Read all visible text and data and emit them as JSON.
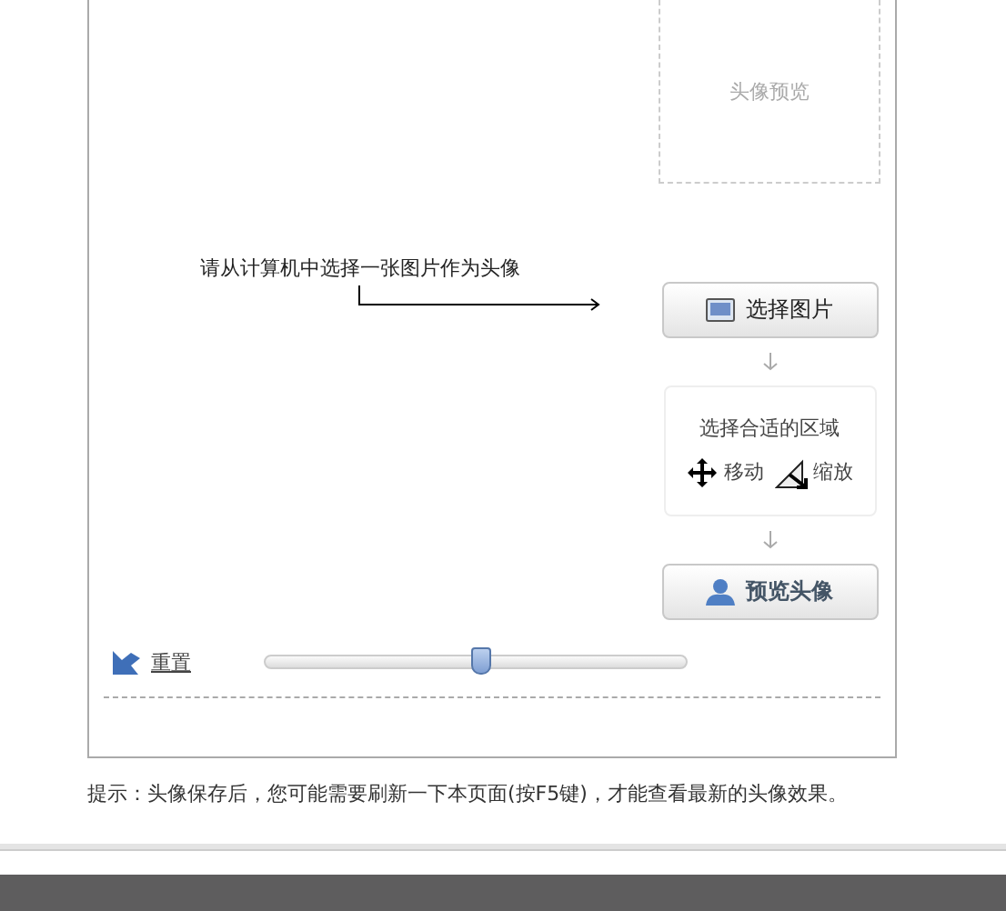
{
  "preview": {
    "label": "头像预览"
  },
  "instruction": "请从计算机中选择一张图片作为头像",
  "select_button": "选择图片",
  "area": {
    "title": "选择合适的区域",
    "tools": [
      {
        "kind": "move",
        "label": "移动"
      },
      {
        "kind": "scale",
        "label": "缩放"
      }
    ]
  },
  "preview_button": "预览头像",
  "zoom": {
    "reset": "重置",
    "level": 0.51
  },
  "hint": "提示：头像保存后，您可能需要刷新一下本页面(按F5键)，才能查看最新的头像效果。"
}
